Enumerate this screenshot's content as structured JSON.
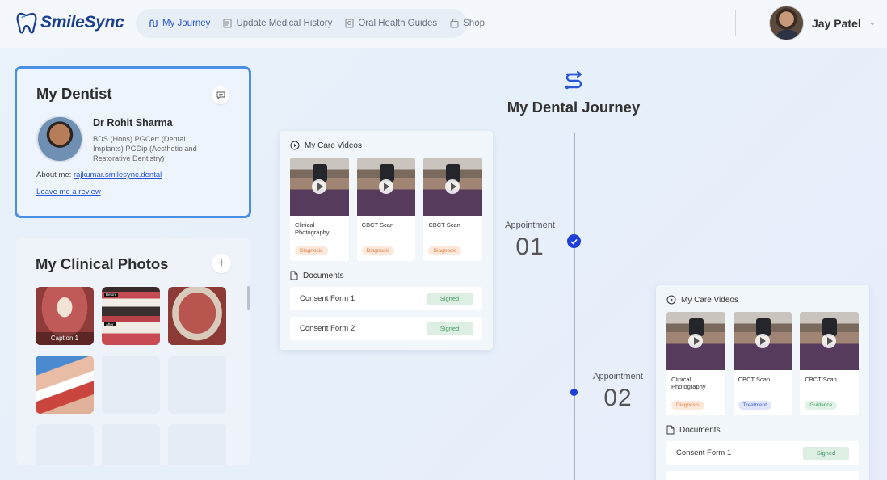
{
  "brand": {
    "name": "SmileSync",
    "logo_color": "#1b3f8f"
  },
  "nav": [
    {
      "label": "My Journey",
      "icon": "route-icon",
      "active": true
    },
    {
      "label": "Update Medical History",
      "icon": "clipboard-icon",
      "active": false
    },
    {
      "label": "Oral Health Guides",
      "icon": "guide-icon",
      "active": false
    },
    {
      "label": "Shop",
      "icon": "bag-icon",
      "active": false
    }
  ],
  "user": {
    "name": "Jay Patel"
  },
  "dentist_card": {
    "title": "My Dentist",
    "name": "Dr Rohit Sharma",
    "qualifications": "BDS (Hons) PGCert (Dental Implants) PGDip (Aesthetic and Restorative Dentistry)",
    "about_label": "About me:",
    "about_link": "rajkumar.smilesync.dental",
    "review_link": "Leave me a review"
  },
  "photos_card": {
    "title": "My Clinical Photos",
    "captions": [
      "Caption 1"
    ],
    "before_after": {
      "before": "Before",
      "after": "After"
    }
  },
  "journey": {
    "title": "My Dental Journey",
    "appointments": [
      {
        "label": "Appointment",
        "number": "01",
        "completed": true,
        "videos_header": "My Care Videos",
        "videos": [
          {
            "title": "Clinical Photography",
            "tag": "Diagnosis",
            "tag_type": "diag"
          },
          {
            "title": "CBCT Scan",
            "tag": "Diagnosis",
            "tag_type": "diag"
          },
          {
            "title": "CBCT Scan",
            "tag": "Diagnosis",
            "tag_type": "diag"
          }
        ],
        "documents_header": "Documents",
        "documents": [
          {
            "name": "Consent Form 1",
            "status": "Signed"
          },
          {
            "name": "Consent Form 2",
            "status": "Signed"
          }
        ]
      },
      {
        "label": "Appointment",
        "number": "02",
        "completed": false,
        "videos_header": "My Care Videos",
        "videos": [
          {
            "title": "Clinical Photography",
            "tag": "Diagnosis",
            "tag_type": "diag"
          },
          {
            "title": "CBCT Scan",
            "tag": "Treatment",
            "tag_type": "treat"
          },
          {
            "title": "CBCT Scan",
            "tag": "Guidance",
            "tag_type": "guide"
          }
        ],
        "documents_header": "Documents",
        "documents": [
          {
            "name": "Consent Form 1",
            "status": "Signed"
          }
        ]
      }
    ]
  },
  "colors": {
    "accent": "#2a56d6",
    "timeline_dot": "#1e40d8",
    "card_border": "#4a90e2"
  }
}
